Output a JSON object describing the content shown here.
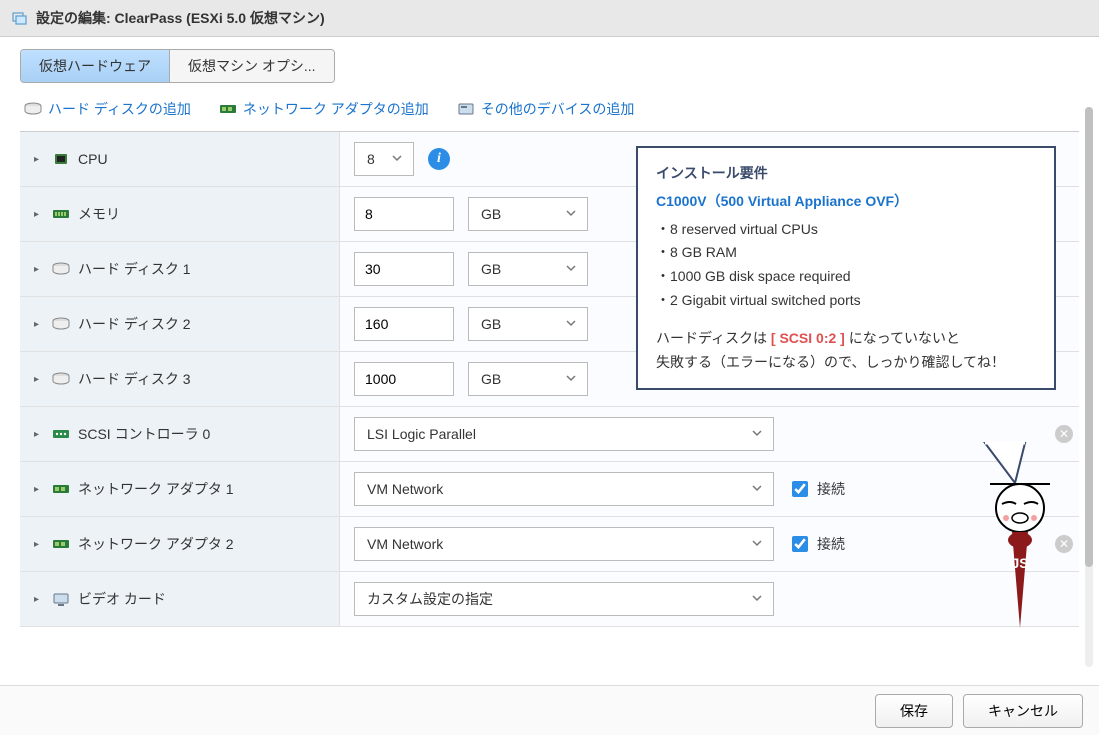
{
  "window": {
    "title": "設定の編集: ClearPass (ESXi 5.0 仮想マシン)"
  },
  "tabs": {
    "hardware": "仮想ハードウェア",
    "options": "仮想マシン オプシ..."
  },
  "toolbar": {
    "add_disk": "ハード ディスクの追加",
    "add_nic": "ネットワーク アダプタの追加",
    "add_other": "その他のデバイスの追加"
  },
  "rows": {
    "cpu": {
      "label": "CPU",
      "value": "8"
    },
    "memory": {
      "label": "メモリ",
      "value": "8",
      "unit": "GB"
    },
    "disk1": {
      "label": "ハード ディスク 1",
      "value": "30",
      "unit": "GB"
    },
    "disk2": {
      "label": "ハード ディスク 2",
      "value": "160",
      "unit": "GB"
    },
    "disk3": {
      "label": "ハード ディスク 3",
      "value": "1000",
      "unit": "GB"
    },
    "scsi": {
      "label": "SCSI コントローラ 0",
      "value": "LSI Logic Parallel"
    },
    "nic1": {
      "label": "ネットワーク アダプタ 1",
      "value": "VM Network",
      "connect": "接続"
    },
    "nic2": {
      "label": "ネットワーク アダプタ 2",
      "value": "VM Network",
      "connect": "接続"
    },
    "video": {
      "label": "ビデオ カード",
      "value": "カスタム設定の指定"
    }
  },
  "footer": {
    "save": "保存",
    "cancel": "キャンセル"
  },
  "callout": {
    "title": "インストール要件",
    "product": "C1000V（500 Virtual Appliance OVF）",
    "b1": "・8 reserved virtual CPUs",
    "b2": "・8 GB RAM",
    "b3": "・1000 GB disk space required",
    "b4": "・2 Gigabit virtual switched ports",
    "note1a": "ハードディスクは ",
    "note1b": "[ SCSI 0:2 ]",
    "note1c": " になっていないと",
    "note2": "失敗する（エラーになる）ので、しっかり確認してね！"
  }
}
